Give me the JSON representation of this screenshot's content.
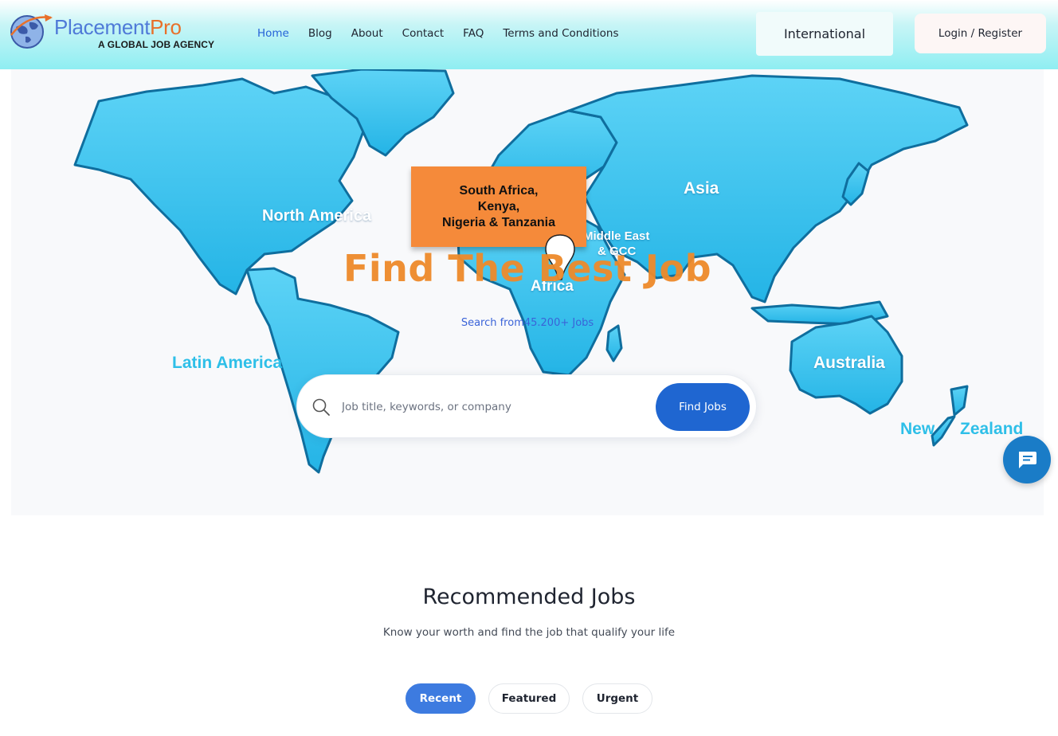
{
  "header": {
    "logo": {
      "name_part1": "Placement",
      "name_part2": "Pro",
      "tagline": "A GLOBAL JOB AGENCY"
    },
    "nav": [
      "Home",
      "Blog",
      "About",
      "Contact",
      "FAQ",
      "Terms and Conditions"
    ],
    "active_nav": "Home",
    "international_label": "International",
    "login_label": "Login / Register"
  },
  "hero": {
    "map_labels": {
      "north_america": "North America",
      "latin_america": "Latin America",
      "asia": "Asia",
      "africa": "Africa",
      "middle_east": "Middle East",
      "gcc": "& GCC",
      "australia": "Australia",
      "new": "New",
      "zealand": "Zealand"
    },
    "callout": {
      "line1": "South Africa,",
      "line2": "Kenya,",
      "line3": "Nigeria & Tanzania"
    },
    "title": "Find The Best Job",
    "subtitle": "Search from45.200+ Jobs",
    "search": {
      "placeholder": "Job title, keywords, or company",
      "value": "",
      "button": "Find Jobs"
    }
  },
  "recommended": {
    "title": "Recommended Jobs",
    "subtitle": "Know your worth and find the job that qualify your life",
    "tabs": [
      "Recent",
      "Featured",
      "Urgent"
    ],
    "active_tab": "Recent"
  },
  "colors": {
    "brand_blue": "#4f7ad8",
    "brand_orange": "#e8702a",
    "primary_button": "#1f66d1",
    "map_continent": "#2ec2f0",
    "callout": "#f58a3a",
    "chat_button": "#1a7cc7"
  },
  "icons": {
    "search": "search-icon",
    "chat": "chat-icon",
    "pin": "map-pin-icon",
    "globe": "globe-logo-icon"
  }
}
